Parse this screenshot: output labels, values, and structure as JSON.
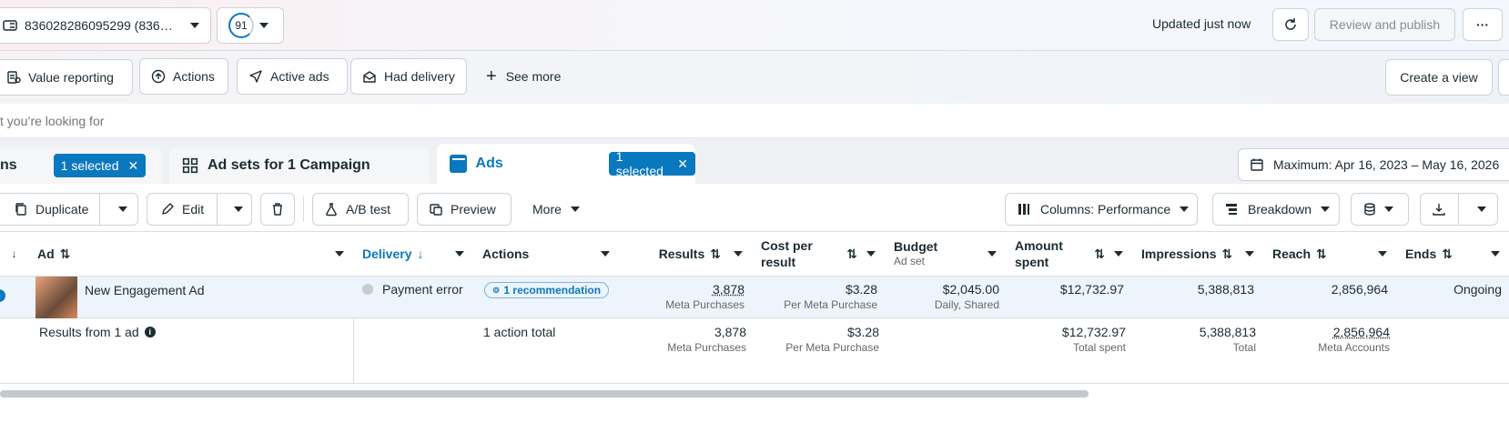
{
  "header": {
    "account": "836028286095299 (836…",
    "score": "91",
    "updated": "Updated just now",
    "review_publish": "Review and publish"
  },
  "filters": {
    "value_reporting": "Value reporting",
    "actions": "Actions",
    "active_ads": "Active ads",
    "had_delivery": "Had delivery",
    "see_more": "See more",
    "create_view": "Create a view"
  },
  "search": {
    "placeholder": "t you’re looking for"
  },
  "tabs": {
    "campaigns_partial": "ns",
    "campaigns_selected": "1 selected",
    "adsets": "Ad sets for 1 Campaign",
    "ads": "Ads",
    "ads_selected": "1 selected",
    "date_range": "Maximum: Apr 16, 2023 – May 16, 2026"
  },
  "toolbar": {
    "duplicate": "Duplicate",
    "edit": "Edit",
    "ab_test": "A/B test",
    "preview": "Preview",
    "more": "More",
    "columns": "Columns: Performance",
    "breakdown": "Breakdown"
  },
  "table": {
    "headers": {
      "ad": "Ad",
      "delivery": "Delivery",
      "actions": "Actions",
      "results": "Results",
      "cost_per_result": "Cost per result",
      "budget": "Budget",
      "budget_sub": "Ad set",
      "amount_spent": "Amount spent",
      "impressions": "Impressions",
      "reach": "Reach",
      "ends": "Ends"
    },
    "row": {
      "name": "New Engagement Ad",
      "delivery": "Payment error",
      "recommendation": "1 recommendation",
      "results": "3,878",
      "results_label": "Meta Purchases",
      "cost": "$3.28",
      "cost_label": "Per Meta Purchase",
      "budget": "$2,045.00",
      "budget_label": "Daily, Shared",
      "amount_spent": "$12,732.97",
      "impressions": "5,388,813",
      "reach": "2,856,964",
      "ends": "Ongoing"
    },
    "totals": {
      "label": "Results from 1 ad",
      "actions": "1 action total",
      "results": "3,878",
      "results_label": "Meta Purchases",
      "cost": "$3.28",
      "cost_label": "Per Meta Purchase",
      "amount_spent": "$12,732.97",
      "amount_label": "Total spent",
      "impressions": "5,388,813",
      "impressions_label": "Total",
      "reach": "2,856,964",
      "reach_label": "Meta Accounts"
    }
  },
  "colors": {
    "accent": "#0a78be",
    "link": "#0a78be"
  }
}
